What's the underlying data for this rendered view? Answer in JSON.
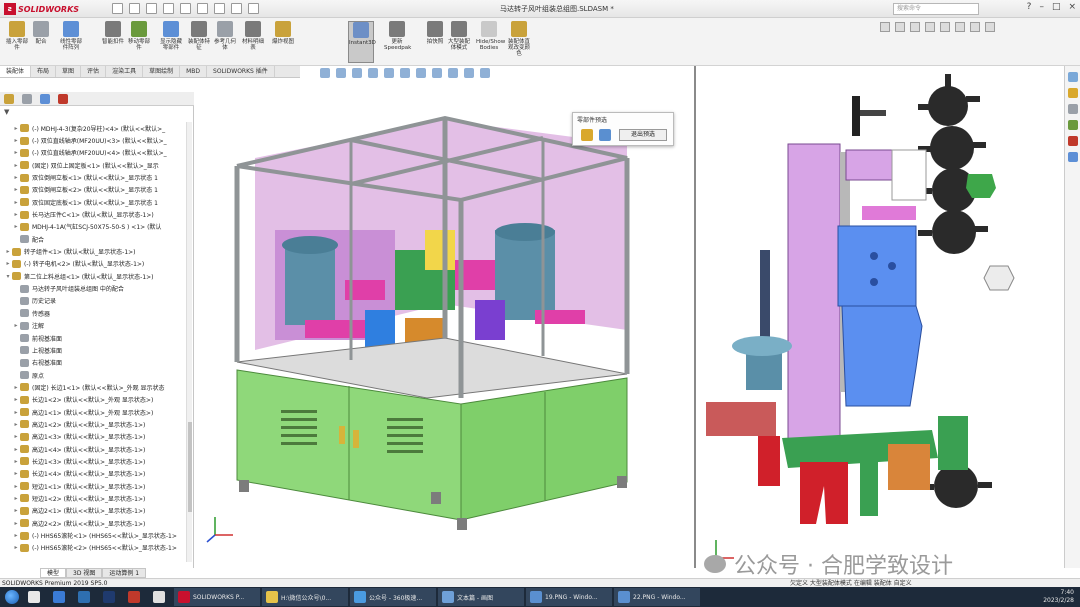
{
  "app": {
    "brand": "SOLIDWORKS",
    "document_title": "马达转子风叶组装总组图.SLDASM *",
    "search_placeholder": "搜索命令"
  },
  "command_manager": [
    {
      "label": "插入零部件",
      "color": "#c9a23b"
    },
    {
      "label": "配合",
      "color": "#9aa0a8"
    },
    {
      "label": "线性零部件阵列",
      "color": "#5d8fd6"
    },
    {
      "label": "智能扣件",
      "color": "#7a7a7a"
    },
    {
      "label": "移动零部件",
      "color": "#6a9a3d"
    },
    {
      "label": "显示隐藏零部件",
      "color": "#5d8fd6"
    },
    {
      "label": "装配体特征",
      "color": "#7a7a7a"
    },
    {
      "label": "参考几何体",
      "color": "#9aa0a8"
    },
    {
      "label": "材料明细表",
      "color": "#7a7a7a"
    },
    {
      "label": "爆炸视图",
      "color": "#c9a23b"
    },
    {
      "label": "Instant3D",
      "color": "#6d8fc6"
    },
    {
      "label": "更新Speedpak",
      "color": "#7a7a7a"
    },
    {
      "label": "拍快照",
      "color": "#7a7a7a"
    },
    {
      "label": "大型装配体模式",
      "color": "#7a7a7a"
    },
    {
      "label": "Hide/Show Bodies",
      "color": "#c9c9c9"
    },
    {
      "label": "装配体直观改变颜色",
      "color": "#c9a23b"
    }
  ],
  "tabs": [
    "装配体",
    "布局",
    "草图",
    "评估",
    "渲染工具",
    "草图绘制",
    "MBD",
    "SOLIDWORKS 插件"
  ],
  "filter_icon": "filter-icon",
  "tree_items": [
    {
      "text": "(-) MDHJ-4-3(复杂20导柱)<4> (默认<<默认>_",
      "color": "#c9a23b",
      "exp": "▸"
    },
    {
      "text": "(-) 双位直线轴承(MF20UU)<3> (默认<<默认>_",
      "color": "#c9a23b",
      "exp": "▸"
    },
    {
      "text": "(-) 双位直线轴承(MF20UU)<4> (默认<<默认>_",
      "color": "#c9a23b",
      "exp": "▸"
    },
    {
      "text": "(固定) 双位上固定板<1> (默认<<默认>_显示",
      "color": "#c9a23b",
      "exp": "▸"
    },
    {
      "text": "双位倒闸立板<1> (默认<<默认>_显示状态 1",
      "color": "#c9a23b",
      "exp": "▸"
    },
    {
      "text": "双位倒闸立板<2> (默认<<默认>_显示状态 1",
      "color": "#c9a23b",
      "exp": "▸"
    },
    {
      "text": "双位固定底板<1> (默认<<默认>_显示状态 1",
      "color": "#c9a23b",
      "exp": "▸"
    },
    {
      "text": "长马达压件C<1> (默认<默认_显示状态-1>)",
      "color": "#c9a23b",
      "exp": "▸"
    },
    {
      "text": "MDHJ-4-1A(气缸SCJ-50X75-50-S ) <1> (默认",
      "color": "#c9a23b",
      "exp": "▸"
    },
    {
      "text": "配合",
      "color": "#9aa0a8",
      "exp": ""
    },
    {
      "text": "转子组件<1> (默认<默认_显示状态-1>)",
      "color": "#c9a23b",
      "exp": "▸"
    },
    {
      "text": "(-) 转子电机<2> (默认<默认_显示状态-1>)",
      "color": "#c9a23b",
      "exp": "▸"
    },
    {
      "text": "第二位上料总组<1> (默认<默认_显示状态-1>)",
      "color": "#c9a23b",
      "exp": "▾"
    },
    {
      "text": "马达转子风叶组装总组图 中的配合",
      "color": "#9aa0a8",
      "exp": ""
    },
    {
      "text": "历史记录",
      "color": "#9aa0a8",
      "exp": ""
    },
    {
      "text": "传感器",
      "color": "#9aa0a8",
      "exp": ""
    },
    {
      "text": "注解",
      "color": "#9aa0a8",
      "exp": "▸"
    },
    {
      "text": "前视基准面",
      "color": "#9aa0a8",
      "exp": ""
    },
    {
      "text": "上视基准面",
      "color": "#9aa0a8",
      "exp": ""
    },
    {
      "text": "右视基准面",
      "color": "#9aa0a8",
      "exp": ""
    },
    {
      "text": "原点",
      "color": "#9aa0a8",
      "exp": ""
    },
    {
      "text": "(固定) 长边1<1> (默认<<默认>_外观 显示状态",
      "color": "#c9a23b",
      "exp": "▸"
    },
    {
      "text": "长边1<2> (默认<<默认>_外观 显示状态>)",
      "color": "#c9a23b",
      "exp": "▸"
    },
    {
      "text": "高边1<1> (默认<<默认>_外观 显示状态>)",
      "color": "#c9a23b",
      "exp": "▸"
    },
    {
      "text": "高边1<2> (默认<<默认>_显示状态-1>)",
      "color": "#c9a23b",
      "exp": "▸"
    },
    {
      "text": "高边1<3> (默认<<默认>_显示状态-1>)",
      "color": "#c9a23b",
      "exp": "▸"
    },
    {
      "text": "高边1<4> (默认<<默认>_显示状态-1>)",
      "color": "#c9a23b",
      "exp": "▸"
    },
    {
      "text": "长边1<3> (默认<<默认>_显示状态-1>)",
      "color": "#c9a23b",
      "exp": "▸"
    },
    {
      "text": "长边1<4> (默认<<默认>_显示状态-1>)",
      "color": "#c9a23b",
      "exp": "▸"
    },
    {
      "text": "短边1<1> (默认<<默认>_显示状态-1>)",
      "color": "#c9a23b",
      "exp": "▸"
    },
    {
      "text": "短边1<2> (默认<<默认>_显示状态-1>)",
      "color": "#c9a23b",
      "exp": "▸"
    },
    {
      "text": "高边2<1> (默认<<默认>_显示状态-1>)",
      "color": "#c9a23b",
      "exp": "▸"
    },
    {
      "text": "高边2<2> (默认<<默认>_显示状态-1>)",
      "color": "#c9a23b",
      "exp": "▸"
    },
    {
      "text": "(-) HHS65滚轮<1> (HHS65<<默认>_显示状态-1>",
      "color": "#c9a23b",
      "exp": "▸"
    },
    {
      "text": "(-) HHS65滚轮<2> (HHS65<<默认>_显示状态-1>",
      "color": "#c9a23b",
      "exp": "▸"
    }
  ],
  "popup": {
    "title": "零部件预选",
    "button": "退出预选"
  },
  "model_tabs": [
    "模型",
    "3D 视图",
    "运动算例 1"
  ],
  "status": {
    "left": "SOLIDWORKS Premium 2019 SP5.0",
    "right": "欠定义    大型装配体模式    在编辑 装配体        自定义"
  },
  "watermark": "公众号 · 合肥学致设计",
  "taskbar": {
    "items": [
      {
        "label": "",
        "color": "#e8e8e8",
        "open": false
      },
      {
        "label": "",
        "color": "#3a7bd5",
        "open": false
      },
      {
        "label": "",
        "color": "#2e6fb0",
        "open": false
      },
      {
        "label": "",
        "color": "#1f3a6e",
        "open": false
      },
      {
        "label": "",
        "color": "#c0392b",
        "open": false
      },
      {
        "label": "",
        "color": "#e0e0e0",
        "open": false
      },
      {
        "label": "SOLIDWORKS P...",
        "color": "#c8102e",
        "open": true
      },
      {
        "label": "H:\\微信公众号\\0...",
        "color": "#e6c34a",
        "open": true
      },
      {
        "label": "公众号 - 360极速...",
        "color": "#4a9be0",
        "open": true
      },
      {
        "label": "文本篇 - 画图",
        "color": "#6fa0d8",
        "open": true
      },
      {
        "label": "19.PNG - Windo...",
        "color": "#5a8fd0",
        "open": true
      },
      {
        "label": "22.PNG - Windo...",
        "color": "#5a8fd0",
        "open": true
      }
    ],
    "time": "7:40",
    "date": "2023/2/28"
  }
}
